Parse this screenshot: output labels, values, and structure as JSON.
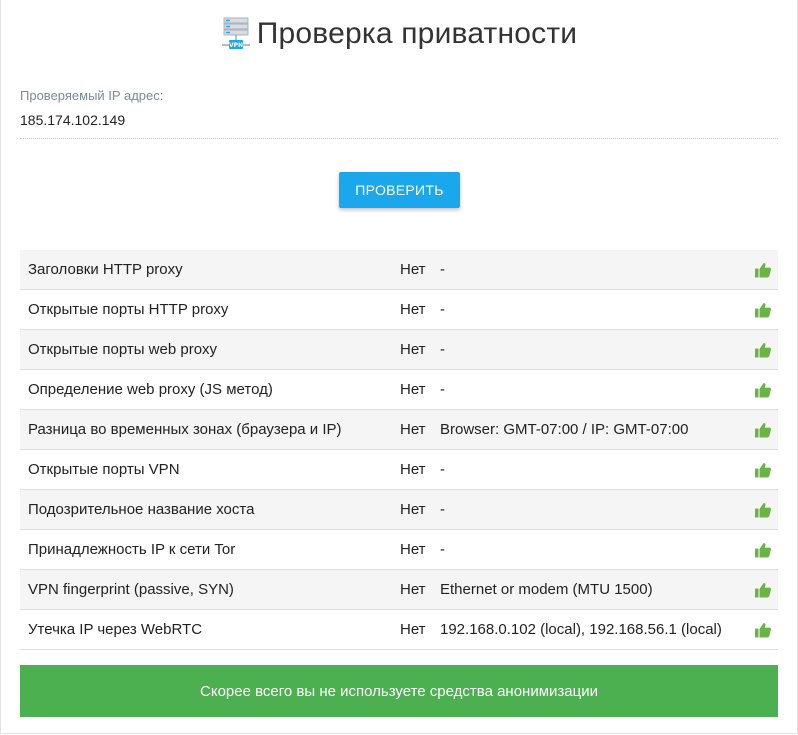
{
  "header": {
    "title": "Проверка приватности",
    "icon": "vpn-server-icon",
    "icon_badge": "VPN"
  },
  "ip": {
    "label": "Проверяемый IP адрес:",
    "value": "185.174.102.149"
  },
  "check_button": {
    "label": "ПРОВЕРИТЬ"
  },
  "results": [
    {
      "name": "Заголовки HTTP proxy",
      "status": "Нет",
      "detail": "-",
      "icon": "thumbs-up-icon"
    },
    {
      "name": "Открытые порты HTTP proxy",
      "status": "Нет",
      "detail": "-",
      "icon": "thumbs-up-icon"
    },
    {
      "name": "Открытые порты web proxy",
      "status": "Нет",
      "detail": "-",
      "icon": "thumbs-up-icon"
    },
    {
      "name": "Определение web proxy (JS метод)",
      "status": "Нет",
      "detail": "-",
      "icon": "thumbs-up-icon"
    },
    {
      "name": "Разница во временных зонах (браузера и IP)",
      "status": "Нет",
      "detail": "Browser: GMT-07:00 / IP: GMT-07:00",
      "icon": "thumbs-up-icon"
    },
    {
      "name": "Открытые порты VPN",
      "status": "Нет",
      "detail": "-",
      "icon": "thumbs-up-icon"
    },
    {
      "name": "Подозрительное название хоста",
      "status": "Нет",
      "detail": "-",
      "icon": "thumbs-up-icon"
    },
    {
      "name": "Принадлежность IP к сети Tor",
      "status": "Нет",
      "detail": "-",
      "icon": "thumbs-up-icon"
    },
    {
      "name": "VPN fingerprint (passive, SYN)",
      "status": "Нет",
      "detail": "Ethernet or modem (MTU 1500)",
      "icon": "thumbs-up-icon"
    },
    {
      "name": "Утечка IP через WebRTC",
      "status": "Нет",
      "detail": "192.168.0.102 (local), 192.168.56.1 (local)",
      "icon": "thumbs-up-icon"
    }
  ],
  "verdict": {
    "text": "Скорее всего вы не используете средства анонимизации"
  },
  "colors": {
    "button": "#1aa7ec",
    "verdict": "#4caf50",
    "thumb": "#6ab344"
  }
}
